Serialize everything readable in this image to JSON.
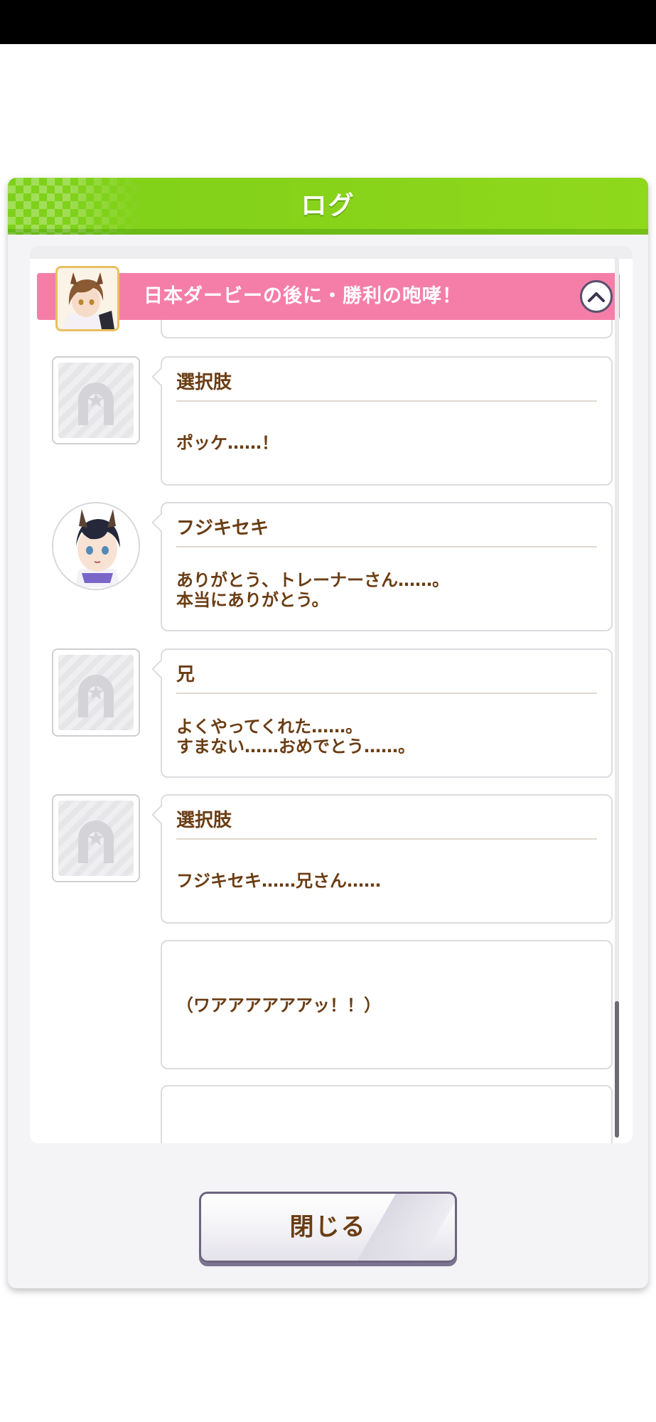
{
  "dialog": {
    "title": "ログ",
    "close_label": "閉じる"
  },
  "banner": {
    "title": "日本ダービーの後に・勝利の咆哮！"
  },
  "entries": [
    {
      "speaker": "選択肢",
      "lines": [
        "ポッケ……！"
      ]
    },
    {
      "speaker": "フジキセキ",
      "lines": [
        "ありがとう、トレーナーさん……。",
        "本当にありがとう。"
      ]
    },
    {
      "speaker": "兄",
      "lines": [
        "よくやってくれた……。",
        "すまない……おめでとう……。"
      ]
    },
    {
      "speaker": "選択肢",
      "lines": [
        "フジキセキ……兄さん……"
      ]
    },
    {
      "speaker": "",
      "lines": [
        "（ワアアアアアアッ！！）"
      ]
    }
  ],
  "colors": {
    "header_green": "#86d21a",
    "banner_pink": "#f57ea8",
    "text_brown": "#6b3d14"
  }
}
